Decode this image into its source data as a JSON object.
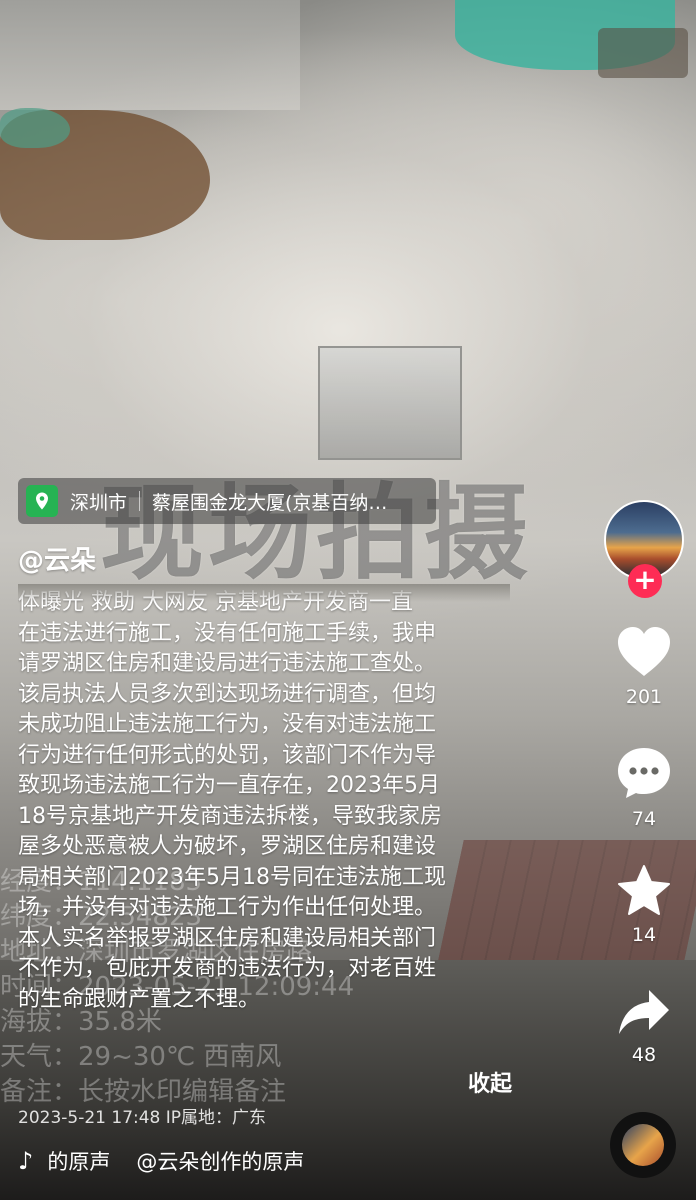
{
  "location": {
    "city": "深圳市",
    "place": "蔡屋围金龙大厦(京基百纳…"
  },
  "author": "@云朵",
  "description": [
    "体曝光 救助 大网友 京基地产开发商一直",
    "在违法进行施工，没有任何施工手续，我申",
    "请罗湖区住房和建设局进行违法施工查处。",
    "该局执法人员多次到达现场进行调查，但均",
    "未成功阻止违法施工行为，没有对违法施工",
    "行为进行任何形式的处罚，该部门不作为导",
    "致现场违法施工行为一直存在，2023年5月",
    "18号京基地产开发商违法拆楼，导致我家房",
    "屋多处恶意被人为破坏，罗湖区住房和建设",
    "局相关部门2023年5月18号同在违法施工现",
    "场，并没有对违法施工行为作出任何处理。",
    "本人实名举报罗湖区住房和建设局相关部门",
    "不作为，包庇开发商的违法行为，对老百姓",
    "的生命跟财产置之不理。"
  ],
  "collapse_label": "收起",
  "meta": {
    "date": "2023-5-21 17:48",
    "ip_label": "IP属地：广东"
  },
  "music": {
    "note_icon": "tiktok-note-icon",
    "left": "的原声",
    "right": "@云朵创作的原声"
  },
  "watermark": "现场拍摄",
  "camera_overlay": [
    "经度：114.1185",
    "纬度：22.54823",
    "地址：深圳市罗湖区住房路",
    "时间：2023-05-21 12:09:44",
    "海拔：35.8米",
    "天气：29~30℃ 西南风",
    "备注：长按水印编辑备注"
  ],
  "actions": {
    "likes": "201",
    "comments": "74",
    "favorites": "14",
    "shares": "48"
  },
  "colors": {
    "follow": "#fe2c55",
    "location_icon": "#26b353"
  }
}
